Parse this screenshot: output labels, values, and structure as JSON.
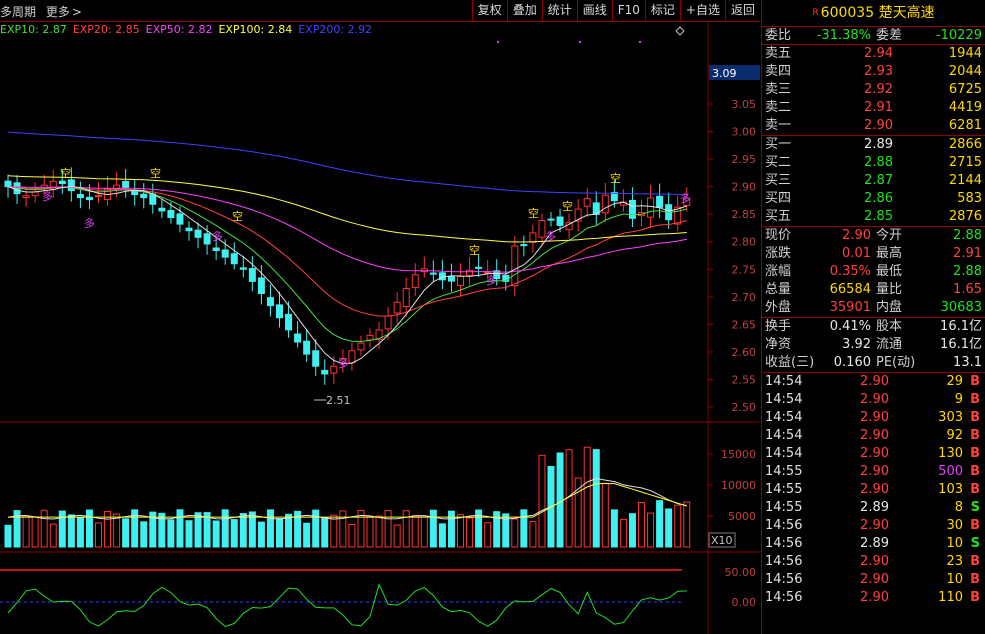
{
  "toolbar": {
    "period_label": "多周期",
    "more_label": "更多",
    "buttons": [
      "复权",
      "叠加",
      "统计",
      "画线",
      "F10",
      "标记",
      "+自选",
      "返回"
    ]
  },
  "ma_legend": [
    {
      "label": "EXP10: 2.87",
      "color": "#40e040"
    },
    {
      "label": "EXP20: 2.85",
      "color": "#ff4040"
    },
    {
      "label": "EXP50: 2.82",
      "color": "#ff40ff"
    },
    {
      "label": "EXP100: 2.84",
      "color": "#ffff40"
    },
    {
      "label": "EXP200: 2.92",
      "color": "#4040ff"
    }
  ],
  "price_axis": {
    "ticks": [
      "3.05",
      "3.00",
      "2.95",
      "2.90",
      "2.85",
      "2.80",
      "2.75",
      "2.70",
      "2.65",
      "2.60",
      "2.55",
      "2.50"
    ],
    "current_label": "3.09",
    "low_marker": "2.51"
  },
  "volume_axis": {
    "ticks": [
      "15000",
      "10000",
      "5000"
    ],
    "unit_label": "X10"
  },
  "indicator_axis": {
    "ticks": [
      "50.00",
      "0.00"
    ]
  },
  "signals": {
    "short": "空",
    "long": "多"
  },
  "colors": {
    "up": "#ff3030",
    "down": "#40f0f0",
    "grid": "#8b0000",
    "yellow": "#ffd800"
  },
  "stock": {
    "mark": "R",
    "code": "600035",
    "name": "楚天高速"
  },
  "ratio": {
    "label1": "委比",
    "value1": "-31.38%",
    "label2": "委差",
    "value2": "-10229"
  },
  "asks": [
    {
      "label": "卖五",
      "price": "2.94",
      "vol": "1944"
    },
    {
      "label": "卖四",
      "price": "2.93",
      "vol": "2044"
    },
    {
      "label": "卖三",
      "price": "2.92",
      "vol": "6725"
    },
    {
      "label": "卖二",
      "price": "2.91",
      "vol": "4419"
    },
    {
      "label": "卖一",
      "price": "2.90",
      "vol": "6281"
    }
  ],
  "bids": [
    {
      "label": "买一",
      "price": "2.89",
      "vol": "2866"
    },
    {
      "label": "买二",
      "price": "2.88",
      "vol": "2715"
    },
    {
      "label": "买三",
      "price": "2.87",
      "vol": "2144"
    },
    {
      "label": "买四",
      "price": "2.86",
      "vol": "583"
    },
    {
      "label": "买五",
      "price": "2.85",
      "vol": "2876"
    }
  ],
  "quote": [
    {
      "l1": "现价",
      "v1": "2.90",
      "l2": "今开",
      "v2": "2.88"
    },
    {
      "l1": "涨跌",
      "v1": "0.01",
      "l2": "最高",
      "v2": "2.91"
    },
    {
      "l1": "涨幅",
      "v1": "0.35%",
      "l2": "最低",
      "v2": "2.88"
    },
    {
      "l1": "总量",
      "v1": "66584",
      "l2": "量比",
      "v2": "1.65"
    },
    {
      "l1": "外盘",
      "v1": "35901",
      "l2": "内盘",
      "v2": "30683"
    }
  ],
  "fundamentals": [
    {
      "l1": "换手",
      "v1": "0.41%",
      "l2": "股本",
      "v2": "16.1亿"
    },
    {
      "l1": "净资",
      "v1": "3.92",
      "l2": "流通",
      "v2": "16.1亿"
    },
    {
      "l1": "收益(三)",
      "v1": "0.160",
      "l2": "PE(动)",
      "v2": "13.1"
    }
  ],
  "trades": [
    {
      "time": "14:54",
      "price": "2.90",
      "vol": "29",
      "side": "B"
    },
    {
      "time": "14:54",
      "price": "2.90",
      "vol": "9",
      "side": "B"
    },
    {
      "time": "14:54",
      "price": "2.90",
      "vol": "303",
      "side": "B"
    },
    {
      "time": "14:54",
      "price": "2.90",
      "vol": "92",
      "side": "B"
    },
    {
      "time": "14:54",
      "price": "2.90",
      "vol": "130",
      "side": "B"
    },
    {
      "time": "14:55",
      "price": "2.90",
      "vol": "500",
      "side": "B"
    },
    {
      "time": "14:55",
      "price": "2.90",
      "vol": "103",
      "side": "B"
    },
    {
      "time": "14:55",
      "price": "2.89",
      "vol": "8",
      "side": "S"
    },
    {
      "time": "14:56",
      "price": "2.90",
      "vol": "30",
      "side": "B"
    },
    {
      "time": "14:56",
      "price": "2.89",
      "vol": "10",
      "side": "S"
    },
    {
      "time": "14:56",
      "price": "2.90",
      "vol": "23",
      "side": "B"
    },
    {
      "time": "14:56",
      "price": "2.90",
      "vol": "10",
      "side": "B"
    },
    {
      "time": "14:56",
      "price": "2.90",
      "vol": "110",
      "side": "B"
    }
  ]
}
